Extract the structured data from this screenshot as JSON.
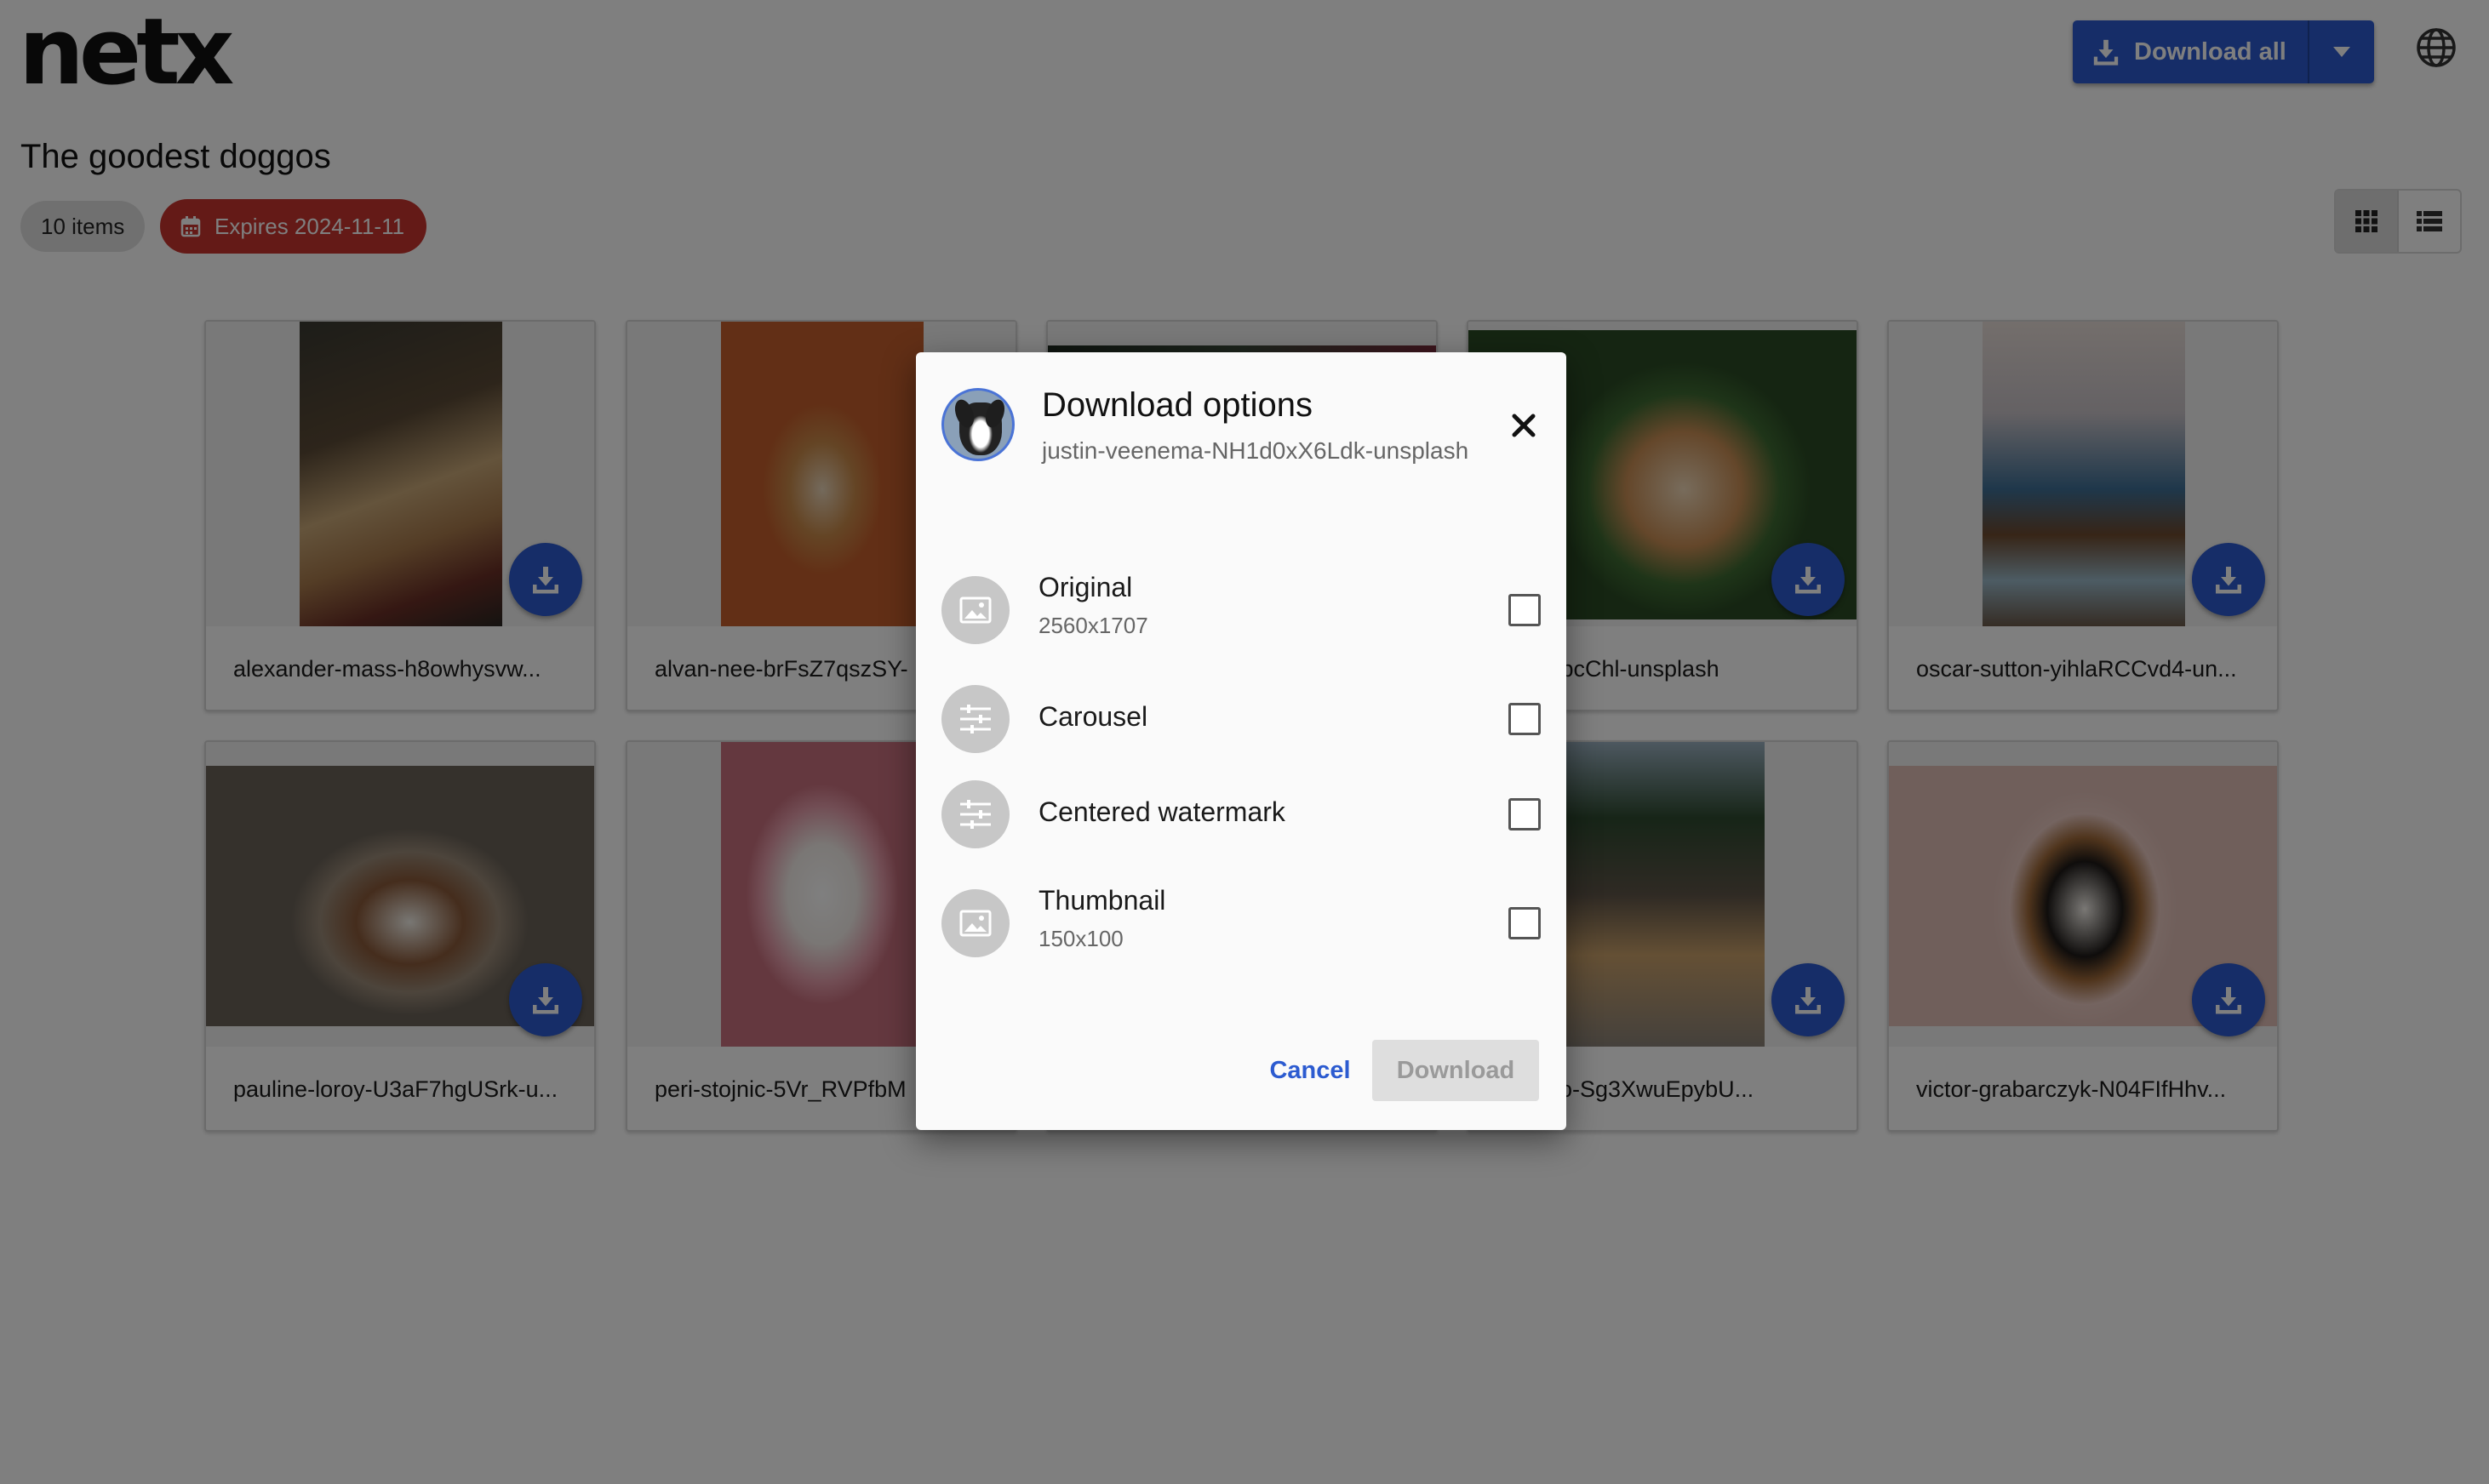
{
  "app": {
    "logo": "netx"
  },
  "header": {
    "download_all_label": "Download all"
  },
  "collection": {
    "title": "The goodest doggos",
    "item_count": "10 items",
    "expires": "Expires 2024-11-11"
  },
  "grid": {
    "items": [
      {
        "name": "alexander-mass-h8owhysvw..."
      },
      {
        "name": "alvan-nee-brFsZ7qszSY-"
      },
      {
        "name": ""
      },
      {
        "name": "0CWTpcChl-unsplash"
      },
      {
        "name": "oscar-sutton-yihlaRCCvd4-un..."
      },
      {
        "name": "pauline-loroy-U3aF7hgUSrk-u..."
      },
      {
        "name": "peri-stojnic-5Vr_RVPfbM"
      },
      {
        "name": ""
      },
      {
        "name": "l-brutyo-Sg3XwuEpybU..."
      },
      {
        "name": "victor-grabarczyk-N04FIfHhv..."
      }
    ]
  },
  "dialog": {
    "title": "Download options",
    "filename": "justin-veenema-NH1d0xX6Ldk-unsplash",
    "options": [
      {
        "label": "Original",
        "sub": "2560x1707",
        "icon": "image-icon",
        "checked": false
      },
      {
        "label": "Carousel",
        "sub": "",
        "icon": "sliders-icon",
        "checked": false
      },
      {
        "label": "Centered watermark",
        "sub": "",
        "icon": "sliders-icon",
        "checked": false
      },
      {
        "label": "Thumbnail",
        "sub": "150x100",
        "icon": "image-icon",
        "checked": false
      }
    ],
    "cancel_label": "Cancel",
    "download_label": "Download"
  },
  "colors": {
    "primary": "#2c5bd0",
    "danger": "#c9342f",
    "overlay": "rgba(0,0,0,0.5)"
  }
}
